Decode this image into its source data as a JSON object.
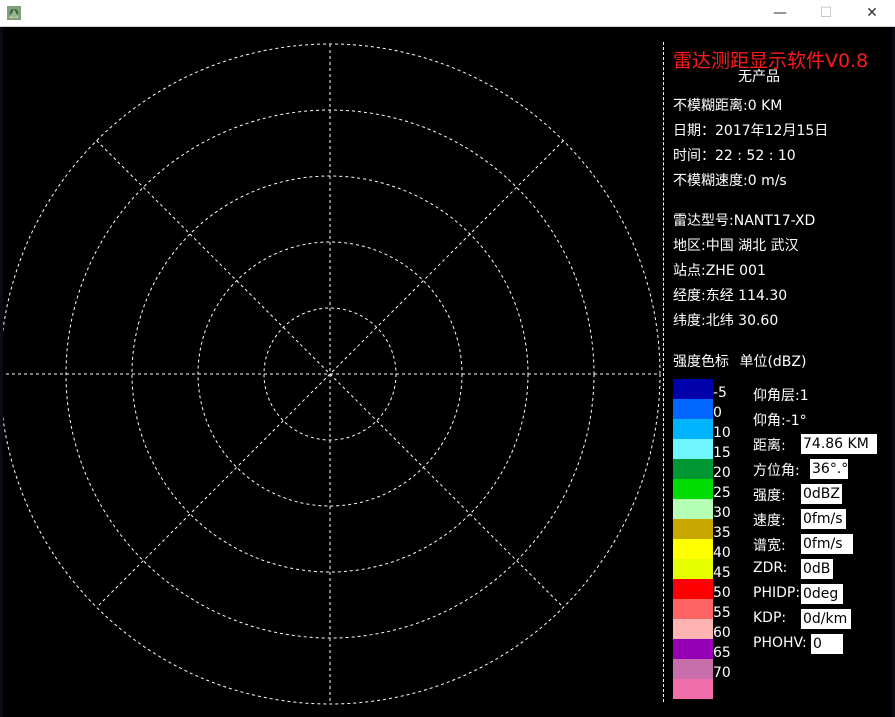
{
  "window": {
    "minimize_glyph": "—",
    "maximize_glyph": "☐",
    "close_glyph": "✕"
  },
  "app": {
    "title": "雷达测距显示软件V0.8",
    "product": "无产品"
  },
  "info": {
    "unambiguous_range": "不模糊距离:0 KM",
    "date": "日期：2017年12月15日",
    "time": "时间：22 : 52 : 10",
    "unambiguous_velocity": "不模糊速度:0 m/s",
    "radar_model": "雷达型号:NANT17-XD",
    "region": "地区:中国 湖北 武汉",
    "station": "站点:ZHE 001",
    "longitude": "经度:东经 114.30",
    "latitude": "纬度:北纬 30.60"
  },
  "scale": {
    "title": "强度色标",
    "unit": "单位(dBZ)",
    "entries": [
      {
        "label": "-5",
        "color": "#0000aa"
      },
      {
        "label": "0",
        "color": "#0066ff"
      },
      {
        "label": "10",
        "color": "#00b4ff"
      },
      {
        "label": "15",
        "color": "#6ff5ff"
      },
      {
        "label": "20",
        "color": "#009632"
      },
      {
        "label": "25",
        "color": "#00dc00"
      },
      {
        "label": "30",
        "color": "#b4ffb4"
      },
      {
        "label": "35",
        "color": "#c8a800"
      },
      {
        "label": "40",
        "color": "#ffff00"
      },
      {
        "label": "45",
        "color": "#e6ff00"
      },
      {
        "label": "50",
        "color": "#ff0000"
      },
      {
        "label": "55",
        "color": "#ff6464"
      },
      {
        "label": "60",
        "color": "#ffb4b4"
      },
      {
        "label": "65",
        "color": "#9600b4"
      },
      {
        "label": "70",
        "color": "#c86eaa"
      },
      {
        "label": "",
        "color": "#f06eaa"
      }
    ]
  },
  "fields": {
    "elevation_layer": "仰角层:1",
    "elevation_angle": "仰角:-1°",
    "distance_label": "距离:",
    "distance_value": "74.86 KM",
    "azimuth_label": "方位角:",
    "azimuth_value": "36°.°",
    "intensity_label": "强度:",
    "intensity_value": "0dBZ",
    "velocity_label": "速度:",
    "velocity_value": "0fm/s",
    "spectrum_label": "谱宽:",
    "spectrum_value": "0fm/s",
    "zdr_label": "ZDR:",
    "zdr_value": "0dB",
    "phidp_label": "PHIDP:",
    "phidp_value": "0deg",
    "kdp_label": "KDP:",
    "kdp_value": "0d/km",
    "phohv_label": "PHOHV:",
    "phohv_value": "0"
  },
  "radar_plot": {
    "rings": 5,
    "spokes": 8,
    "line_color": "#ffffff",
    "background": "#000000"
  }
}
